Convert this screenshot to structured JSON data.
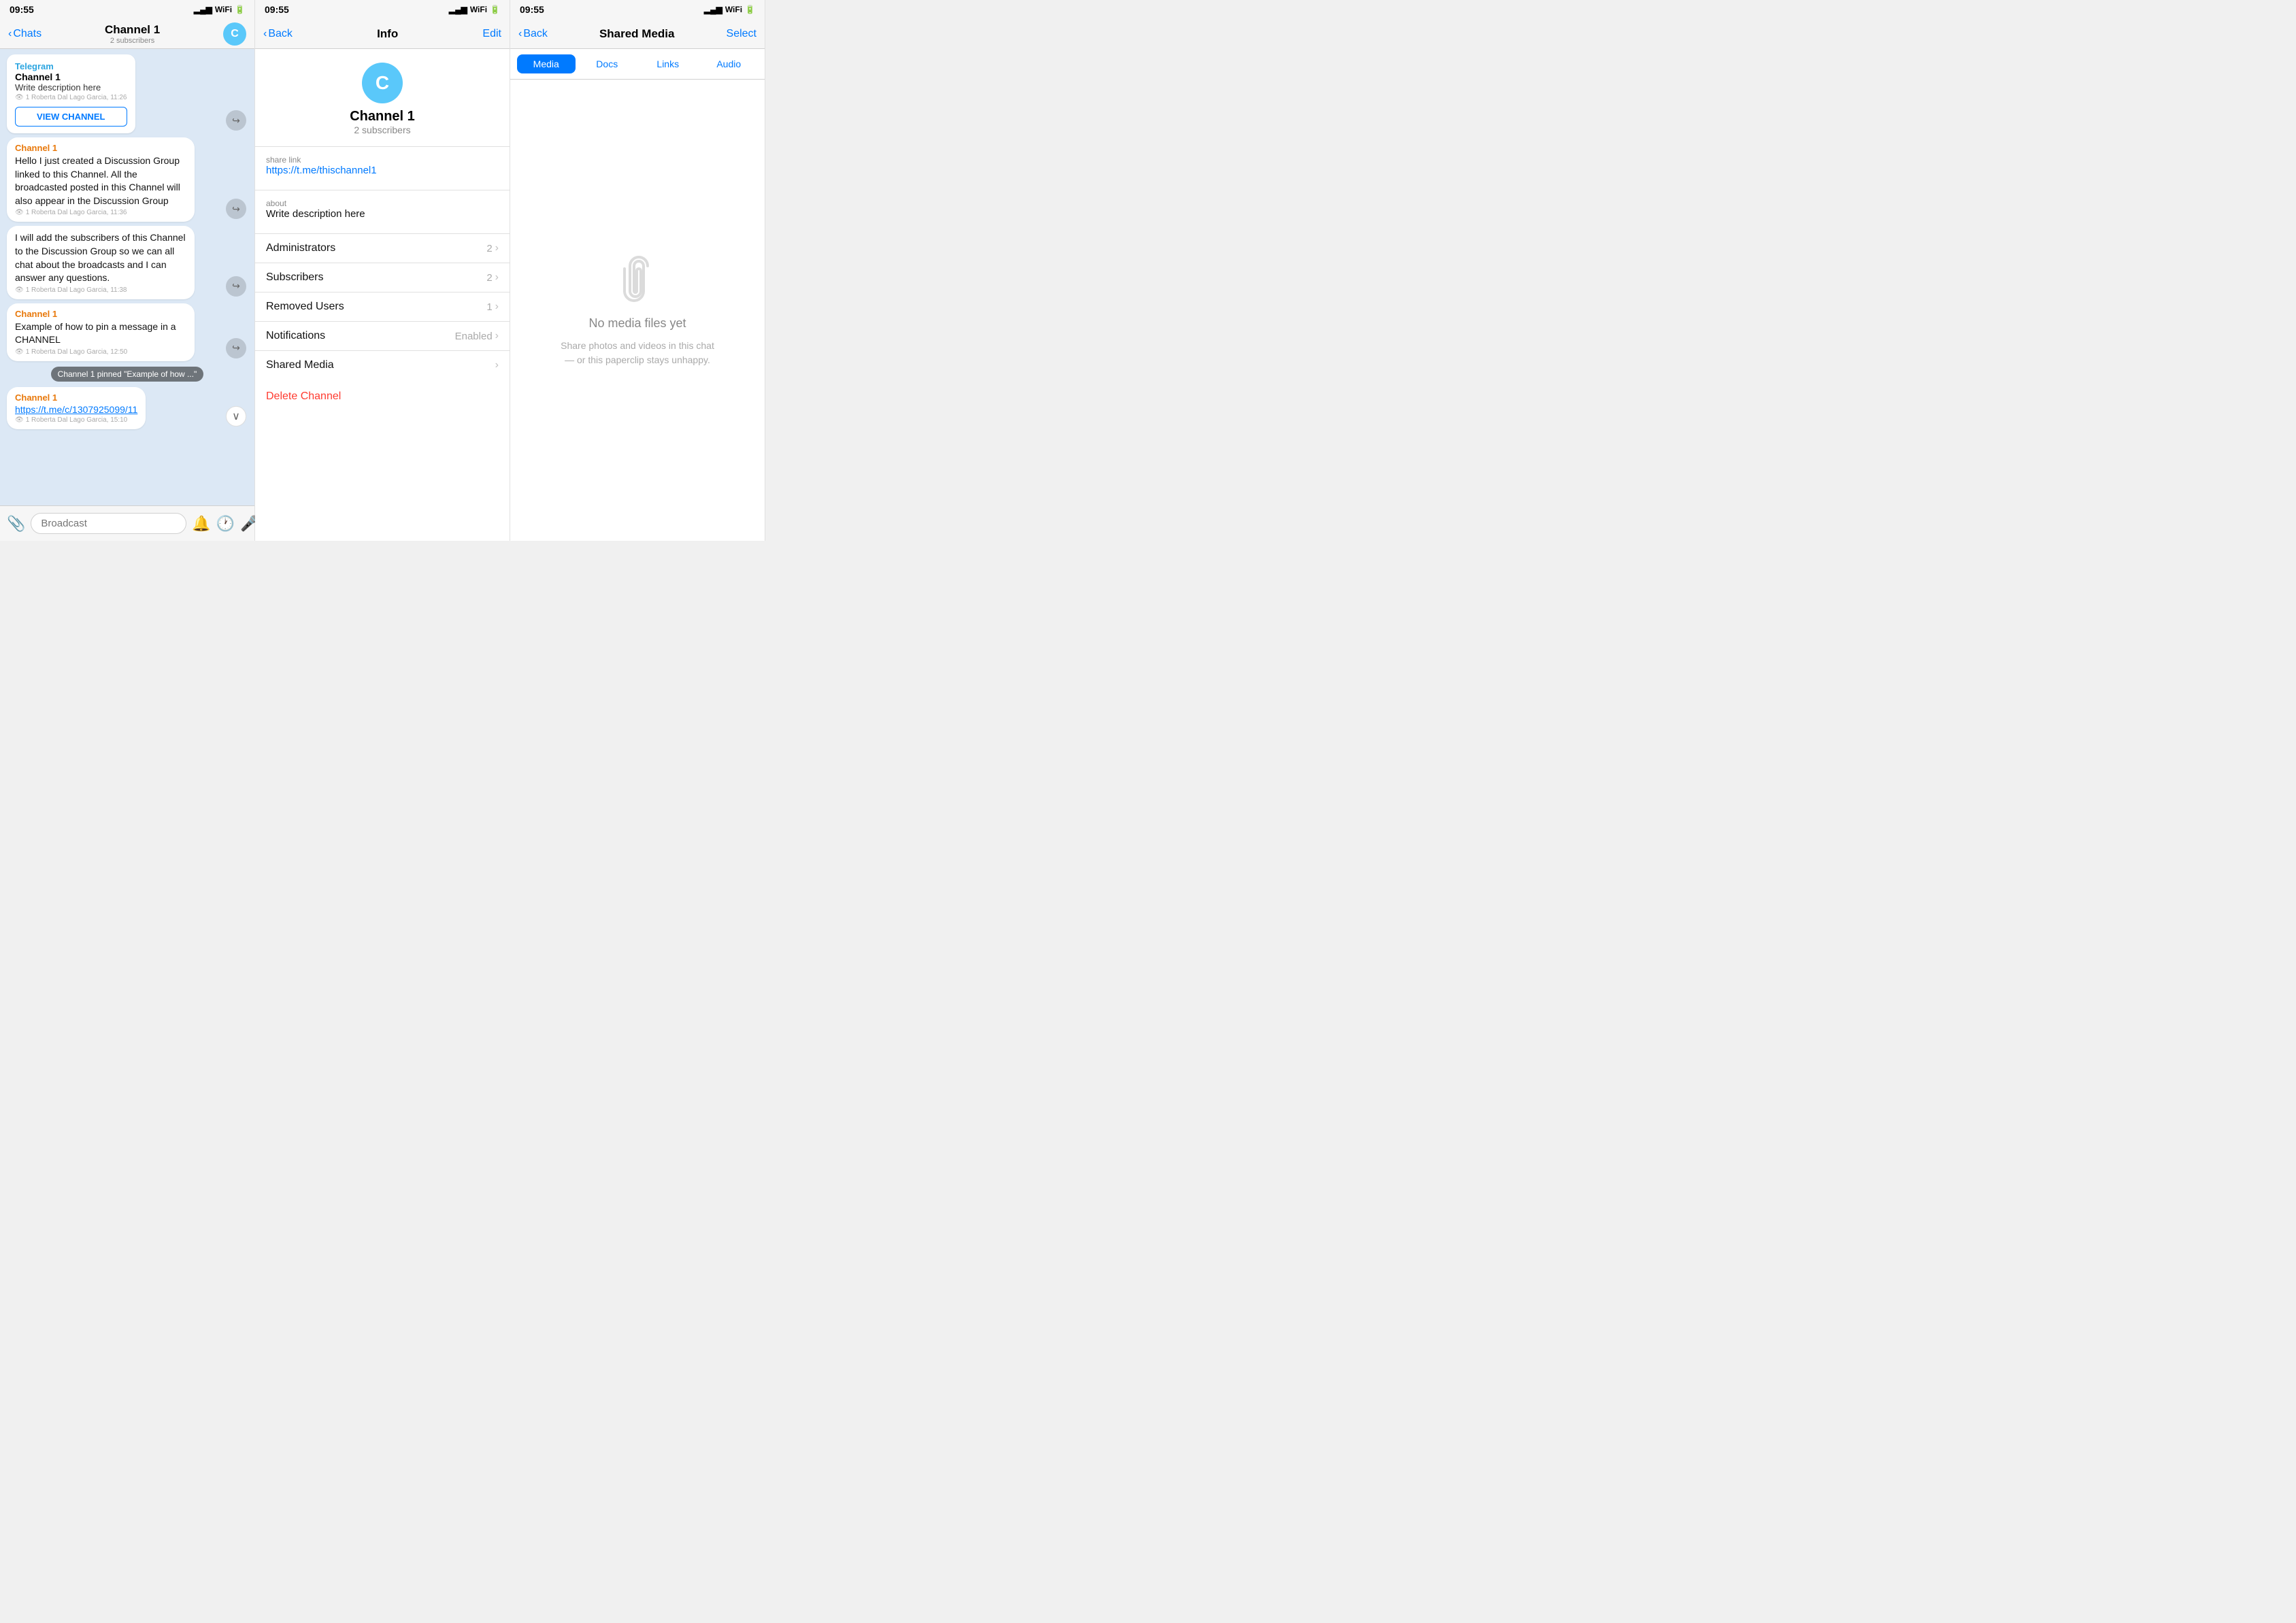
{
  "panels": {
    "panel1": {
      "statusBar": {
        "time": "09:55",
        "location": true
      },
      "navBack": "Chats",
      "navTitle": "Channel 1",
      "navSubtitle": "2 subscribers",
      "messages": [
        {
          "type": "header",
          "telegramLabel": "Telegram",
          "channelName": "Channel 1",
          "description": "Write description here",
          "meta": "1 Roberta Dal Lago Garcia, 11:26",
          "viewBtn": "VIEW CHANNEL"
        },
        {
          "type": "channel",
          "sender": "Channel 1",
          "text": "Hello I just created a Discussion Group linked to this Channel. All the broadcasted posted in this Channel will also appear in the Discussion Group",
          "meta": "1 Roberta Dal Lago Garcia, 11:36"
        },
        {
          "type": "plain",
          "text": "I will add the subscribers of this Channel to the Discussion Group so we can all chat about the broadcasts and I can answer any questions.",
          "meta": "1 Roberta Dal Lago Garcia, 11:38"
        },
        {
          "type": "channel",
          "sender": "Channel 1",
          "text": "Example of how to pin a message in a CHANNEL",
          "meta": "1 Roberta Dal Lago Garcia, 12:50"
        },
        {
          "type": "pinned",
          "text": "Channel 1 pinned \"Example of how ...\""
        },
        {
          "type": "channel",
          "sender": "Channel 1",
          "link": "https://t.me/c/1307925099/11",
          "meta": "1 Roberta Dal Lago Garcia, 15:10",
          "hasScrollDown": true
        }
      ],
      "inputPlaceholder": "Broadcast"
    },
    "panel2": {
      "statusBar": {
        "time": "09:55"
      },
      "navBack": "Back",
      "navTitle": "Info",
      "navAction": "Edit",
      "avatar": "C",
      "channelName": "Channel 1",
      "subscribers": "2 subscribers",
      "shareLinkLabel": "share link",
      "shareLink": "https://t.me/thischannel1",
      "aboutLabel": "about",
      "aboutText": "Write description here",
      "listItems": [
        {
          "label": "Administrators",
          "value": "2",
          "hasChevron": true
        },
        {
          "label": "Subscribers",
          "value": "2",
          "hasChevron": true
        },
        {
          "label": "Removed Users",
          "value": "1",
          "hasChevron": true
        },
        {
          "label": "Notifications",
          "value": "Enabled",
          "hasChevron": true
        },
        {
          "label": "Shared Media",
          "value": "",
          "hasChevron": true
        }
      ],
      "deleteLabel": "Delete Channel"
    },
    "panel3": {
      "statusBar": {
        "time": "09:55"
      },
      "navBack": "Back",
      "navTitle": "Shared Media",
      "navAction": "Select",
      "tabs": [
        "Media",
        "Docs",
        "Links",
        "Audio"
      ],
      "activeTab": "Media",
      "emptyTitle": "No media files yet",
      "emptyDesc": "Share photos and videos in this chat\n— or this paperclip stays unhappy."
    }
  }
}
